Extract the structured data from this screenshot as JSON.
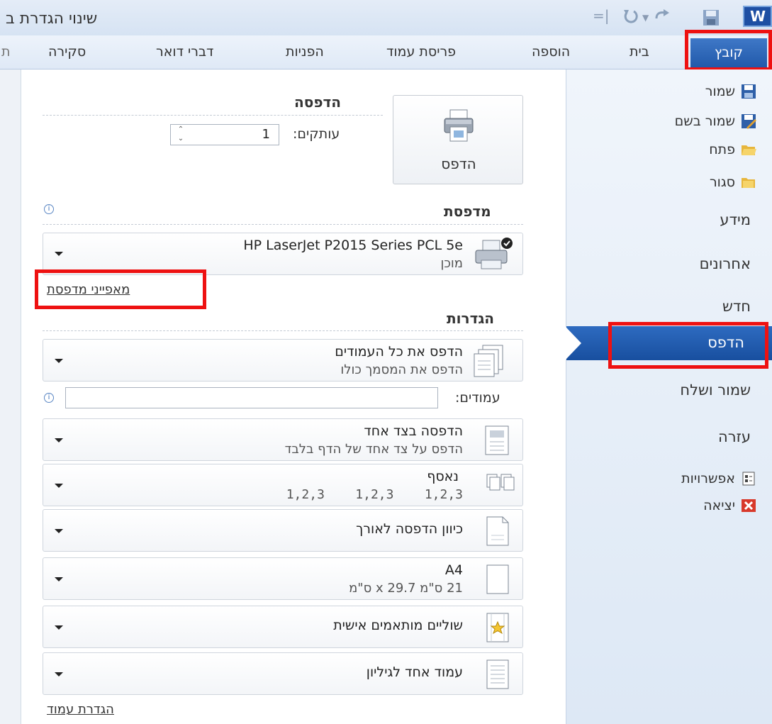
{
  "window": {
    "title": "שינוי הגדרת ב"
  },
  "ribbon": {
    "tabs": [
      {
        "label": "קובץ"
      },
      {
        "label": "בית"
      },
      {
        "label": "הוספה"
      },
      {
        "label": "פריסת עמוד"
      },
      {
        "label": "הפניות"
      },
      {
        "label": "דברי דואר"
      },
      {
        "label": "סקירה"
      }
    ],
    "word_logo": "W"
  },
  "nav": {
    "items": [
      {
        "label": "שמור",
        "icon": "save-icon"
      },
      {
        "label": "שמור בשם",
        "icon": "save-as-icon"
      },
      {
        "label": "פתח",
        "icon": "open-folder-icon"
      },
      {
        "label": "סגור",
        "icon": "close-folder-icon"
      },
      {
        "label": "מידע"
      },
      {
        "label": "אחרונים"
      },
      {
        "label": "חדש"
      },
      {
        "label": "הדפס",
        "selected": true
      },
      {
        "label": "שמור ושלח"
      },
      {
        "label": "עזרה"
      },
      {
        "label": "אפשרויות",
        "icon": "options-icon"
      },
      {
        "label": "יציאה",
        "icon": "exit-icon"
      }
    ]
  },
  "print": {
    "heading": "הדפסה",
    "button_label": "הדפס",
    "copies_label": "עותקים:",
    "copies_value": "1"
  },
  "printer": {
    "heading": "מדפסת",
    "name": "HP LaserJet P2015 Series PCL 5e",
    "status": "מוכן",
    "properties_link": "מאפייני מדפסת"
  },
  "settings": {
    "heading": "הגדרות",
    "pages_label": "עמודים:",
    "pages_value": "",
    "options": [
      {
        "main": "הדפס את כל העמודים",
        "sub": "הדפס את המסמך כולו"
      },
      {
        "main": "הדפסה בצד אחד",
        "sub": "הדפס על צד אחד של הדף בלבד"
      },
      {
        "main": "נאסף",
        "sub": "1,2,3    1,2,3    1,2,3"
      },
      {
        "main": "כיוון הדפסה לאורך",
        "sub": ""
      },
      {
        "main": "A4",
        "sub": "21 ס\"מ x 29.7 ס\"מ"
      },
      {
        "main": "שוליים מותאמים אישית",
        "sub": ""
      },
      {
        "main": "עמוד אחד לגיליון",
        "sub": ""
      }
    ],
    "page_setup_link": "הגדרת עמוד"
  },
  "colors": {
    "accent": "#1f57a8",
    "highlight": "#ee1111"
  }
}
